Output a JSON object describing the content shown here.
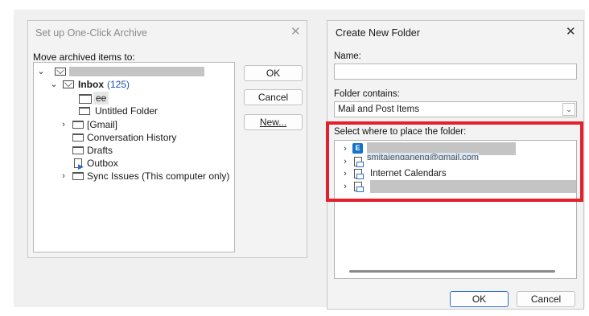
{
  "archive_dialog": {
    "title": "Set up One-Click Archive",
    "move_label": "Move archived items to:",
    "tree": {
      "inbox_label": "Inbox",
      "inbox_count": "(125)",
      "ee_label": "ee",
      "untitled_label": "Untitled Folder",
      "gmail_label": "[Gmail]",
      "conversation_label": "Conversation History",
      "drafts_label": "Drafts",
      "outbox_label": "Outbox",
      "sync_label": "Sync Issues (This computer only)"
    },
    "buttons": {
      "ok": "OK",
      "cancel": "Cancel",
      "new": "New..."
    }
  },
  "new_folder_dialog": {
    "title": "Create New Folder",
    "name_label": "Name:",
    "name_value": "",
    "contains_label": "Folder contains:",
    "contains_value": "Mail and Post Items",
    "place_label": "Select where to place the folder:",
    "tree": {
      "partial_email": "smitajenganeng@gmail.com",
      "internet_calendars": "Internet Calendars"
    },
    "buttons": {
      "ok": "OK",
      "cancel": "Cancel"
    }
  },
  "colors": {
    "highlight": "#e3202c",
    "accent": "#2a6fcb",
    "count": "#1f4fa8"
  },
  "icons": [
    "close-icon",
    "chevron-down-icon",
    "chevron-right-icon",
    "folder-icon",
    "mail-icon",
    "outbox-icon",
    "exchange-icon",
    "dropdown-icon"
  ]
}
